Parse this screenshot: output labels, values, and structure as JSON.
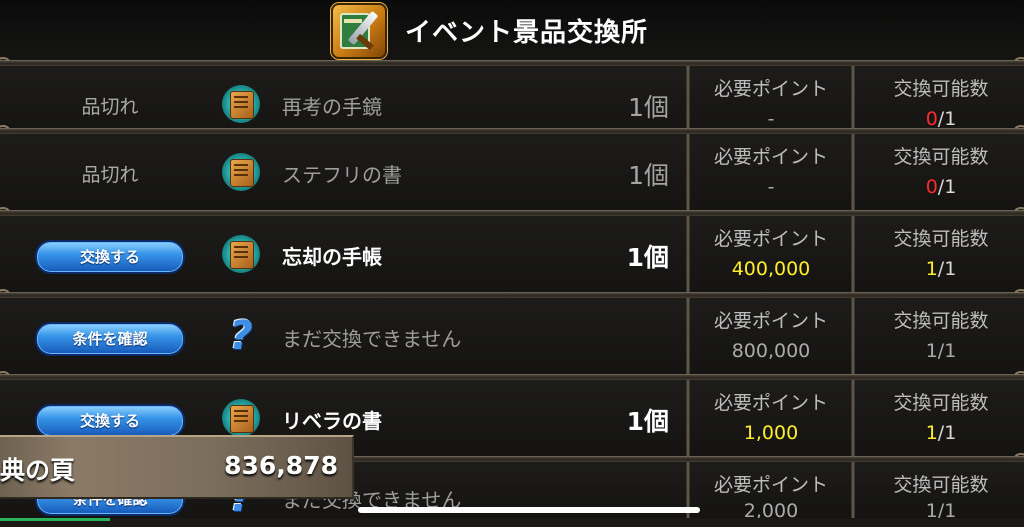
{
  "header": {
    "title": "イベント景品交換所",
    "icon": "event-shop-icon"
  },
  "labels": {
    "points_label": "必要ポイント",
    "limit_label": "交換可能数"
  },
  "rows": [
    {
      "status": "品切れ",
      "icon": "book-icon",
      "name": "再考の手鏡",
      "qty": "1個",
      "points": "-",
      "limit_current": "0",
      "limit_total": "/1"
    },
    {
      "status": "品切れ",
      "icon": "book-icon",
      "name": "ステフリの書",
      "qty": "1個",
      "points": "-",
      "limit_current": "0",
      "limit_total": "/1"
    },
    {
      "button": "交換する",
      "icon": "book-icon",
      "name": "忘却の手帳",
      "qty": "1個",
      "points": "400,000",
      "limit_current": "1",
      "limit_total": "/1"
    },
    {
      "button": "条件を確認",
      "icon": "question-icon",
      "name": "まだ交換できません",
      "qty": "",
      "points": "800,000",
      "limit_current": "1",
      "limit_total": "/1"
    },
    {
      "button": "交換する",
      "icon": "book-icon",
      "name": "リベラの書",
      "qty": "1個",
      "points": "1,000",
      "limit_current": "1",
      "limit_total": "/1"
    },
    {
      "button": "条件を確認",
      "icon": "question-icon",
      "name": "まだ交換できません",
      "qty": "",
      "points": "2,000",
      "limit_current": "1",
      "limit_total": "/1"
    }
  ],
  "points_panel": {
    "label": "典の頁",
    "value": "836,878"
  },
  "colors": {
    "accent_yellow": "#ffee2a",
    "sold_out_red": "#ff2a2a",
    "button_blue": "#3795e8"
  }
}
